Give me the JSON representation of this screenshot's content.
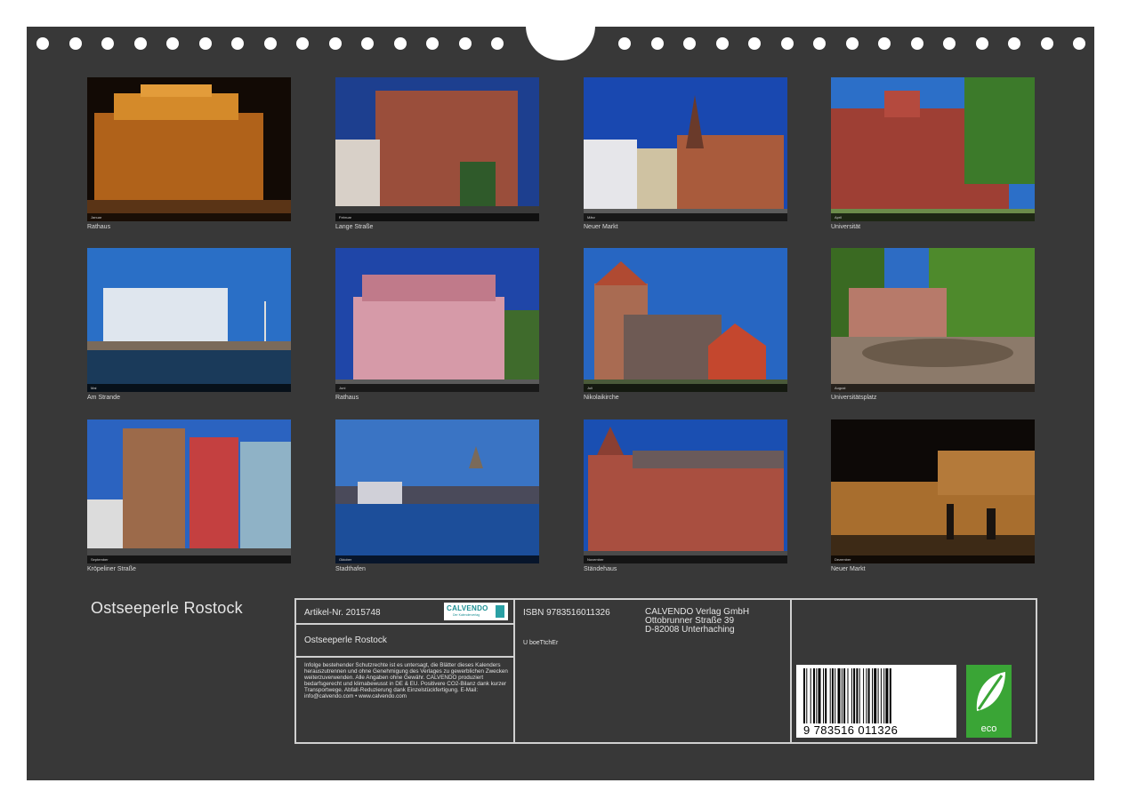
{
  "photos": [
    {
      "caption": "Rathaus",
      "month": "Januar"
    },
    {
      "caption": "Lange Straße",
      "month": "Februar"
    },
    {
      "caption": "Neuer Markt",
      "month": "März"
    },
    {
      "caption": "Universität",
      "month": "April"
    },
    {
      "caption": "Am Strande",
      "month": "Mai"
    },
    {
      "caption": "Rathaus",
      "month": "Juni"
    },
    {
      "caption": "Nikolaikirche",
      "month": "Juli"
    },
    {
      "caption": "Universitätsplatz",
      "month": "August"
    },
    {
      "caption": "Kröpeliner Straße",
      "month": "September"
    },
    {
      "caption": "Stadthafen",
      "month": "Oktober"
    },
    {
      "caption": "Ständehaus",
      "month": "November"
    },
    {
      "caption": "Neuer Markt",
      "month": "Dezember"
    }
  ],
  "calendar": {
    "title": "Ostseeperle Rostock",
    "article": "Artikel-Nr. 2015748",
    "product_title": "Ostseeperle Rostock",
    "isbn": "ISBN 9783516011326",
    "subtitle_code": "U boeTtchEr",
    "legal_text": "Infolge bestehender Schutzrechte ist es untersagt, die Blätter dieses Kalenders herauszutrennen und ohne Genehmigung des Verlages zu gewerblichen Zwecken weiterzuverwenden. Alle Angaben ohne Gewähr. CALVENDO produziert bedarfsgerecht und klimabewusst in DE & EU. Positivere CO2-Bilanz dank kurzer Transportwege. Abfall-Reduzierung dank Einzelstückfertigung. E-Mail: info@calvendo.com • www.calvendo.com",
    "publisher": {
      "name": "CALVENDO Verlag GmbH",
      "street": "Ottobrunner Straße 39",
      "city": "D-82008 Unterhaching"
    },
    "barcode_number": "9 783516 011326",
    "logo": {
      "word": "CALVENDO",
      "sub": "Der Kalenderverlag"
    },
    "eco_label": "eco"
  },
  "colors": {
    "background": "#383838",
    "frame": "#d0d0d0",
    "eco": "#3aa536",
    "brand": "#1c8f93"
  }
}
